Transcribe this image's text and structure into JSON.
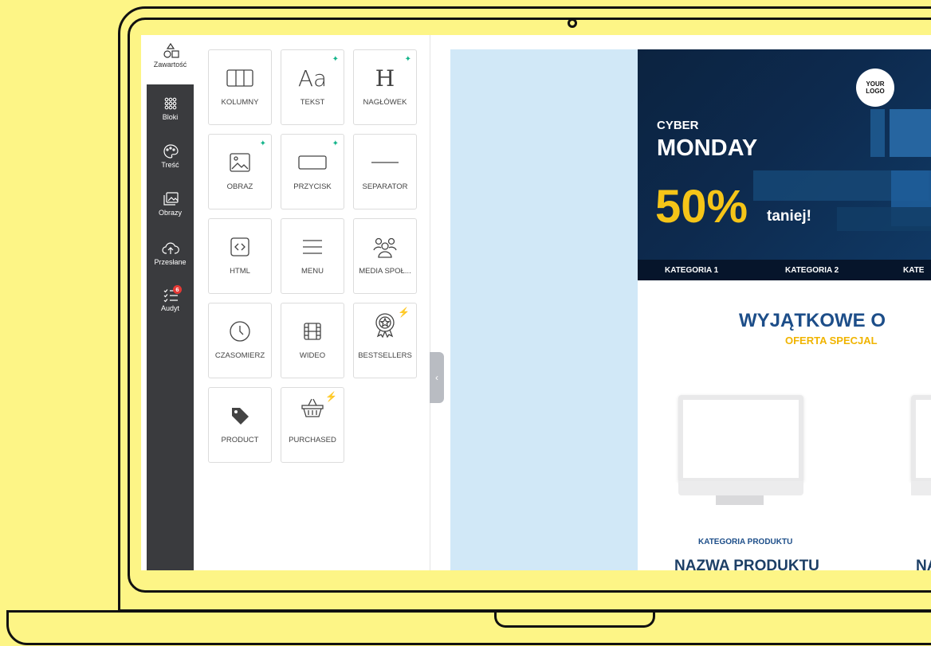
{
  "rail": {
    "items": [
      {
        "label": "Zawartość",
        "icon": "shapes-icon"
      },
      {
        "label": "Bloki",
        "icon": "blocks-grid-icon"
      },
      {
        "label": "Treść",
        "icon": "palette-icon"
      },
      {
        "label": "Obrazy",
        "icon": "images-icon"
      },
      {
        "label": "Przesłane",
        "icon": "cloud-upload-icon"
      },
      {
        "label": "Audyt",
        "icon": "checklist-icon",
        "badge": "6"
      }
    ]
  },
  "blocks": [
    {
      "label": "KOLUMNY",
      "icon": "columns-icon"
    },
    {
      "label": "TEKST",
      "icon": "text-icon",
      "glyph": "Aa",
      "ai": true
    },
    {
      "label": "NAGŁÓWEK",
      "icon": "heading-icon",
      "glyph": "H",
      "ai": true
    },
    {
      "label": "OBRAZ",
      "icon": "image-icon",
      "ai": true
    },
    {
      "label": "PRZYCISK",
      "icon": "button-icon",
      "ai": true
    },
    {
      "label": "SEPARATOR",
      "icon": "separator-icon"
    },
    {
      "label": "HTML",
      "icon": "code-icon"
    },
    {
      "label": "MENU",
      "icon": "menu-icon"
    },
    {
      "label": "MEDIA SPOŁ...",
      "icon": "social-icon"
    },
    {
      "label": "CZASOMIERZ",
      "icon": "clock-icon"
    },
    {
      "label": "WIDEO",
      "icon": "video-icon"
    },
    {
      "label": "BESTSELLERS",
      "icon": "award-icon",
      "premium": true
    },
    {
      "label": "PRODUCT",
      "icon": "tag-icon"
    },
    {
      "label": "PURCHASED",
      "icon": "basket-icon",
      "premium": true
    }
  ],
  "banner": {
    "logo": "YOUR LOGO",
    "cyber": "CYBER",
    "monday": "MONDAY",
    "percent": "50%",
    "taniej": "taniej!",
    "nav": [
      "KATEGORIA 1",
      "KATEGORIA 2",
      "KATE"
    ]
  },
  "section": {
    "title": "WYJĄTKOWE O",
    "subtitle": "OFERTA SPECJAL",
    "product_category": "KATEGORIA PRODUKTU",
    "product_name": "NAZWA PRODUKTU",
    "product_name_2": "NA"
  },
  "colors": {
    "rail_bg": "#3a3b3e",
    "canvas_bg": "#d1e8f7",
    "banner_bg": "#0c2340",
    "accent_yellow": "#f5c518",
    "title_blue": "#1d4e89",
    "ai_badge": "#14b48a",
    "page_bg": "#fdf586"
  }
}
